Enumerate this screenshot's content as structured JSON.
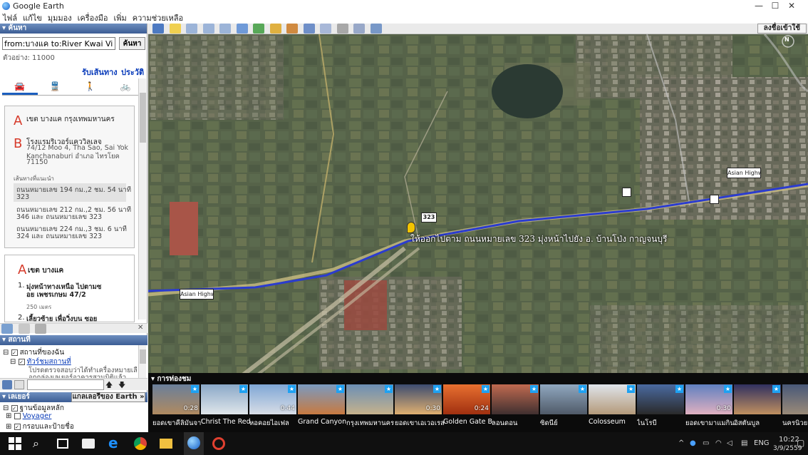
{
  "window": {
    "title": "Google Earth",
    "minimize": "—",
    "maximize": "☐",
    "close": "✕"
  },
  "menu": [
    "ไฟล์",
    "แก้ไข",
    "มุมมอง",
    "เครื่องมือ",
    "เพิ่ม",
    "ความช่วยเหลือ"
  ],
  "search": {
    "section": "▾ ค้นหา",
    "value": "from:บางแค to:River Kwai Village",
    "button": "ค้นหา",
    "example": "ตัวอย่าง: 11000",
    "get_directions": "รับเส้นทาง",
    "history": "ประวัติ",
    "tabs": [
      {
        "name": "car",
        "glyph": "🚘"
      },
      {
        "name": "transit",
        "glyph": "🚆"
      },
      {
        "name": "walk",
        "glyph": "🚶"
      },
      {
        "name": "bike",
        "glyph": "🚲"
      }
    ],
    "point_a": {
      "letter": "A",
      "text": "เขต บางแค กรุงเทพมหานคร"
    },
    "point_b": {
      "letter": "B",
      "name": "โรงแรมริเวอร์แคววิลเลจ",
      "address_line1": "74/12 Moo 4, Tha Sao, Sai Yok",
      "address_line2": "Kanchanaburi อำเภอ ไทรโยค",
      "address_line3": "71150"
    },
    "routes_label": "เส้นทางที่แนะนำ",
    "routes": [
      {
        "line1": "ถนนหมายเลข    194 กม.,2 ชม. 54 นาที",
        "line2": "323"
      },
      {
        "line1": "ถนนหมายเลข    212 กม.,2 ชม. 56 นาที",
        "line2": "346 และ ถนนหมายเลข 323"
      },
      {
        "line1": "ถนนหมายเลข    224 กม.,3 ชม. 6 นาที",
        "line2": "324 และ ถนนหมายเลข 323"
      }
    ],
    "step_start": {
      "letter": "A",
      "text": "เขต บางแค"
    },
    "step1": {
      "num": "1.",
      "text_a": "มุ่งหน้าทางเหนือ ไปตามซ",
      "text_b": "อย เพชรเกษม 47/2",
      "distance": "250 เมตร"
    },
    "step2": {
      "num": "2.",
      "text": "เลี้ยวซ้าย เพื่อวิ่งบน ซอย"
    }
  },
  "places": {
    "section": "▾ สถานที่",
    "my_places": "สถานที่ของฉัน",
    "tour": "ทัวร์ชมสถานที่",
    "tour_note1": "โปรดตรวจสอบว่าได้ทำเครื่องหมายเลื",
    "tour_note2": "อกกล่องเลเยอร์อาคารสามมิติแล้ว"
  },
  "layers": {
    "section": "▾ เลเยอร์",
    "gallery": "แกลเลอรีของ Earth »",
    "primary_db": "ฐานข้อมูลหลัก",
    "voyager": "Voyager",
    "borders": "กรอบและป้ายชื่อ"
  },
  "map_toolbar": {
    "signin": "ลงชื่อเข้าใช้"
  },
  "map": {
    "route_label": "ให้ออกไปตาม ถนนหมายเลข 323 มุ่งหน้าไปยัง อ. บ้านโป่ง กาญจนบุรี",
    "road_shield": "323",
    "highway_left": "Asian Highw",
    "highway_right": "Asian Highw",
    "compass": "N"
  },
  "tours": {
    "label": "▾ การท่องชม",
    "items": [
      {
        "name": "ยอดเขาคีลิมันจาโร",
        "dur": "0:28",
        "bg": "linear-gradient(#6a7f9a,#b08a60)"
      },
      {
        "name": "Christ The Redeemer",
        "dur": "",
        "bg": "linear-gradient(#8aa8c8,#e0e6ea)"
      },
      {
        "name": "หอคอยไอเฟล",
        "dur": "0:44",
        "bg": "linear-gradient(#7fa7d6,#d8dde6)"
      },
      {
        "name": "Grand Canyon",
        "dur": "",
        "bg": "linear-gradient(#7a9ac0,#c87a40)"
      },
      {
        "name": "กรุงเทพมหานคร",
        "dur": "",
        "bg": "linear-gradient(#6b8fb5,#c6b28c)"
      },
      {
        "name": "ยอดเขาเอเวอเรสต์",
        "dur": "0:30",
        "bg": "linear-gradient(#3c4c70,#e0b070)"
      },
      {
        "name": "Golden Gate Bridge",
        "dur": "0:24",
        "bg": "linear-gradient(#e87030,#a03010)"
      },
      {
        "name": "ลอนดอน",
        "dur": "",
        "bg": "linear-gradient(#c06a50,#403030)"
      },
      {
        "name": "ซิดนีย์",
        "dur": "",
        "bg": "linear-gradient(#90a8c0,#505a68)"
      },
      {
        "name": "Colosseum",
        "dur": "",
        "bg": "linear-gradient(#dfe4ea,#b49a7a)"
      },
      {
        "name": "ไนโรบี",
        "dur": "",
        "bg": "linear-gradient(#4a6aa0,#2a2a2a)"
      },
      {
        "name": "ยอดเขามาแมกินลีย์",
        "dur": "0:30",
        "bg": "linear-gradient(#6080c0,#e0b0c0)"
      },
      {
        "name": "อิสตันบูล",
        "dur": "",
        "bg": "linear-gradient(#303060,#c09060)"
      },
      {
        "name": "นครนิวยอร์ก",
        "dur": "",
        "bg": "linear-gradient(#485878,#9a8a78)"
      }
    ]
  },
  "taskbar": {
    "lang": "ENG",
    "time": "10:22",
    "date": "3/9/2559"
  },
  "colors": {
    "route": "#2b3ccf",
    "accent": "#1c5fbf",
    "pin": "#f2c400"
  }
}
